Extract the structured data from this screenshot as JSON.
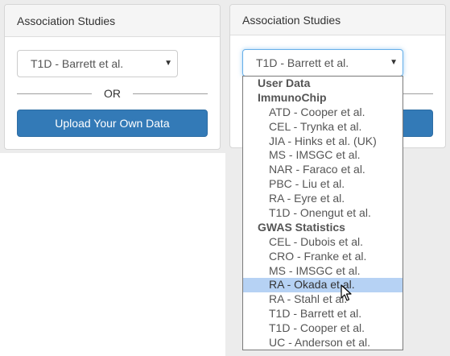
{
  "left_panel": {
    "title": "Association Studies",
    "select_value": "T1D - Barrett et al.",
    "or_label": "OR",
    "upload_button": "Upload Your Own Data"
  },
  "right_panel": {
    "title": "Association Studies",
    "select_value": "T1D - Barrett et al."
  },
  "dropdown": {
    "group_user": "User Data",
    "group_immunochip": "ImmunoChip",
    "immunochip": [
      "ATD - Cooper et al.",
      "CEL - Trynka et al.",
      "JIA - Hinks et al. (UK)",
      "MS - IMSGC et al.",
      "NAR - Faraco et al.",
      "PBC - Liu et al.",
      "RA - Eyre et al.",
      "T1D - Onengut et al."
    ],
    "group_gwas": "GWAS Statistics",
    "gwas": [
      "CEL - Dubois et al.",
      "CRO - Franke et al.",
      "MS - IMSGC et al.",
      "RA - Okada et al.",
      "RA - Stahl et al.",
      "T1D - Barrett et al.",
      "T1D - Cooper et al.",
      "UC - Anderson et al."
    ],
    "highlighted": "RA - Okada et al."
  },
  "colors": {
    "primary": "#337ab7",
    "highlight": "#b6d2f4",
    "focus": "#66afe9"
  },
  "icons": [
    "caret-down-icon",
    "mouse-pointer-icon"
  ]
}
